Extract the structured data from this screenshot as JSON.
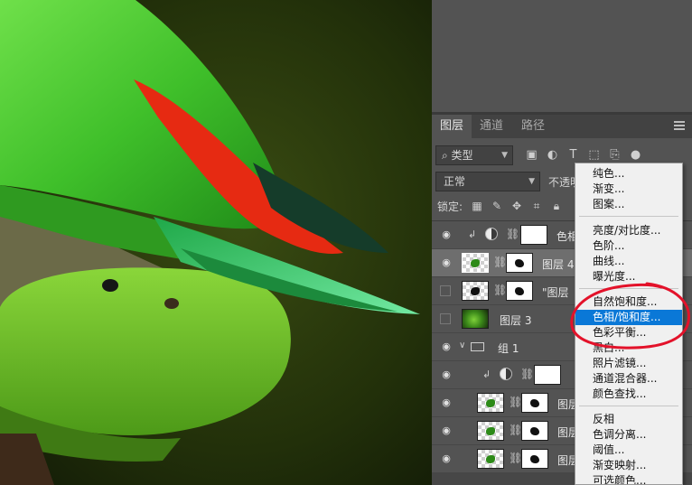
{
  "panel": {
    "tabs": [
      {
        "label": "图层",
        "active": true
      },
      {
        "label": "通道",
        "active": false
      },
      {
        "label": "路径",
        "active": false
      }
    ],
    "filter_kind": "类型",
    "blend_mode": "正常",
    "opacity_label": "不透明",
    "lock_label": "锁定:"
  },
  "layers": [
    {
      "name": "色相",
      "visible": true,
      "kind": "adjustment",
      "clipped": true,
      "indent": 0
    },
    {
      "name": "图层 4",
      "visible": true,
      "kind": "masked",
      "selected": true,
      "indent": 0
    },
    {
      "name": "\"图层",
      "visible": false,
      "kind": "masked",
      "indent": 0
    },
    {
      "name": "图层 3",
      "visible": false,
      "kind": "photo",
      "indent": 0
    },
    {
      "name": "组 1",
      "visible": true,
      "kind": "group",
      "indent": 0
    },
    {
      "name": "",
      "visible": true,
      "kind": "adjustment",
      "clipped": true,
      "indent": 1
    },
    {
      "name": "图层",
      "visible": true,
      "kind": "masked",
      "indent": 1
    },
    {
      "name": "图层",
      "visible": true,
      "kind": "masked",
      "indent": 1
    },
    {
      "name": "图层",
      "visible": true,
      "kind": "masked",
      "indent": 1
    }
  ],
  "adjustment_menu": {
    "groups": [
      [
        "纯色...",
        "渐变...",
        "图案..."
      ],
      [
        "亮度/对比度...",
        "色阶...",
        "曲线...",
        "曝光度..."
      ],
      [
        "自然饱和度...",
        "色相/饱和度...",
        "色彩平衡...",
        "黑白...",
        "照片滤镜...",
        "通道混合器...",
        "颜色查找..."
      ],
      [
        "反相",
        "色调分离...",
        "阈值...",
        "渐变映射...",
        "可选颜色..."
      ]
    ],
    "highlighted": "色相/饱和度...",
    "highlight_color": "#0a78d7"
  },
  "annotation_color": "#e3122a"
}
